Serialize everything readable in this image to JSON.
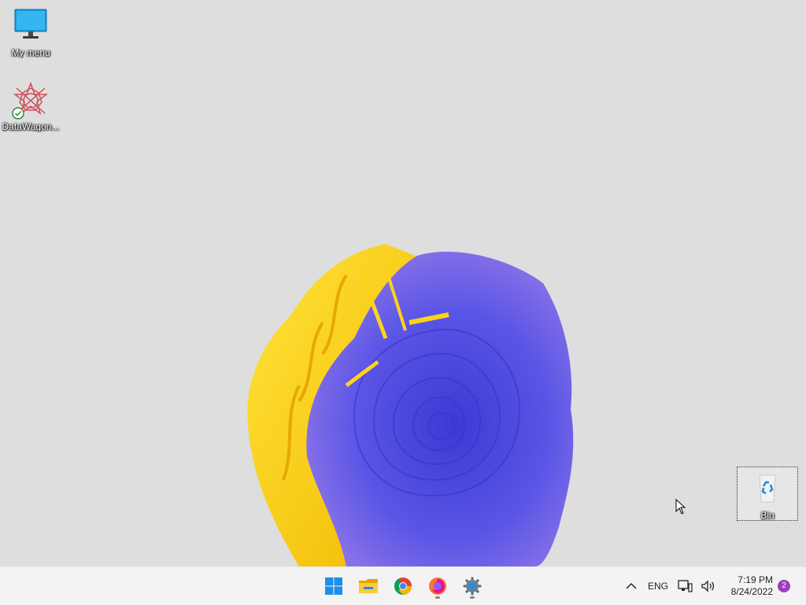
{
  "desktop": {
    "icons": [
      {
        "label": "My menu",
        "icon": "monitor-icon"
      },
      {
        "label": "DataWagon...",
        "icon": "datawagon-app-icon"
      },
      {
        "label": "Bin",
        "icon": "recycle-bin-icon"
      }
    ]
  },
  "taskbar": {
    "apps": [
      {
        "name": "Start",
        "icon": "windows-start-icon"
      },
      {
        "name": "File Explorer",
        "icon": "folder-icon"
      },
      {
        "name": "Chrome",
        "icon": "chrome-icon"
      },
      {
        "name": "Firefox",
        "icon": "firefox-icon"
      },
      {
        "name": "Settings",
        "icon": "gear-icon"
      }
    ],
    "tray": {
      "language": "ENG",
      "time": "7:19 PM",
      "date": "8/24/2022",
      "notification_count": "2"
    }
  },
  "colors": {
    "notification_badge": "#9b3fbf",
    "wallpaper_blue": "#5a55e6",
    "wallpaper_yellow": "#ffd21a"
  }
}
